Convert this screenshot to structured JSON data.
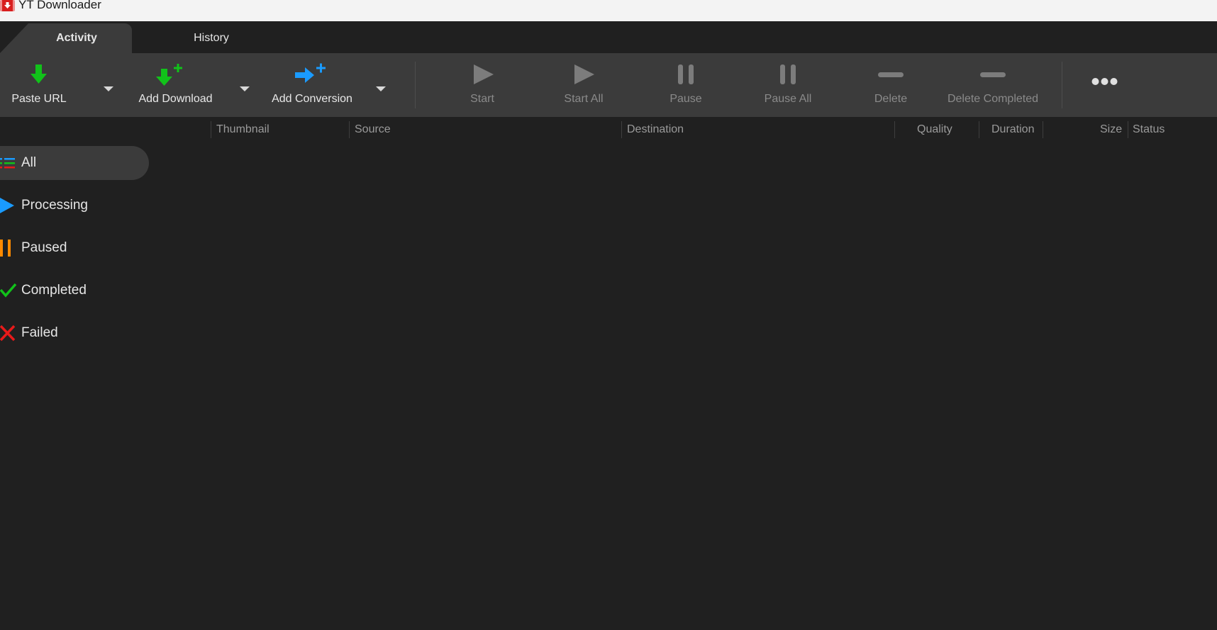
{
  "window": {
    "title": "YT Downloader"
  },
  "tabs": [
    {
      "label": "Activity",
      "active": true
    },
    {
      "label": "History",
      "active": false
    }
  ],
  "toolbar": {
    "paste_url": "Paste URL",
    "add_download": "Add Download",
    "add_conversion": "Add Conversion",
    "start": "Start",
    "start_all": "Start All",
    "pause": "Pause",
    "pause_all": "Pause All",
    "delete": "Delete",
    "delete_completed": "Delete Completed"
  },
  "columns": {
    "thumbnail": "Thumbnail",
    "source": "Source",
    "destination": "Destination",
    "quality": "Quality",
    "duration": "Duration",
    "size": "Size",
    "status": "Status"
  },
  "sidebar": {
    "items": [
      {
        "label": "All",
        "icon": "list-icon",
        "selected": true
      },
      {
        "label": "Processing",
        "icon": "play-icon",
        "selected": false
      },
      {
        "label": "Paused",
        "icon": "pause-icon",
        "selected": false
      },
      {
        "label": "Completed",
        "icon": "check-icon",
        "selected": false
      },
      {
        "label": "Failed",
        "icon": "x-icon",
        "selected": false
      }
    ]
  },
  "colors": {
    "green": "#11c21a",
    "blue": "#1a9bff",
    "orange": "#ff8a00",
    "red": "#e81a1a",
    "disabled_icon": "#7c7c7c"
  }
}
